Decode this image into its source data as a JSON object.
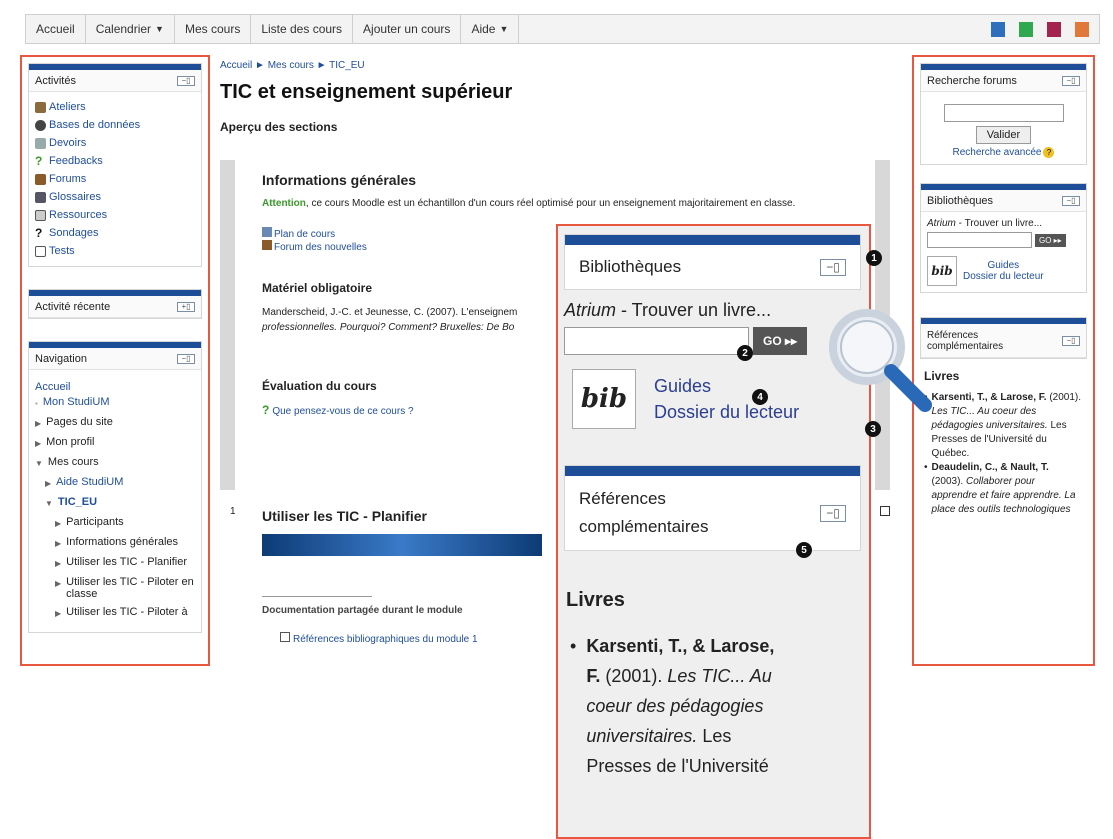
{
  "topnav": {
    "items": [
      {
        "label": "Accueil"
      },
      {
        "label": "Calendrier",
        "caret": "▼"
      },
      {
        "label": "Mes cours"
      },
      {
        "label": "Liste des cours"
      },
      {
        "label": "Ajouter un cours"
      },
      {
        "label": "Aide",
        "caret": "▼"
      }
    ],
    "swatches": [
      "#2f6ebd",
      "#2fa84f",
      "#a3254f",
      "#e0783a"
    ]
  },
  "left": {
    "activites": {
      "title": "Activités",
      "items": [
        "Ateliers",
        "Bases de données",
        "Devoirs",
        "Feedbacks",
        "Forums",
        "Glossaires",
        "Ressources",
        "Sondages",
        "Tests"
      ]
    },
    "recent": {
      "title": "Activité récente"
    },
    "navigation": {
      "title": "Navigation",
      "home": "Accueil",
      "my_studium": "Mon StudiUM",
      "site_pages": "Pages du site",
      "profile": "Mon profil",
      "my_courses": "Mes cours",
      "aide": "Aide StudiUM",
      "course": "TIC_EU",
      "participants": "Participants",
      "infos": "Informations générales",
      "planifier": "Utiliser les TIC - Planifier",
      "piloter": "Utiliser les TIC - Piloter en classe",
      "piloter2": "Utiliser les TIC - Piloter à"
    }
  },
  "main": {
    "breadcrumb": "Accueil ► Mes cours ► TIC_EU",
    "title": "TIC et enseignement supérieur",
    "overview": "Aperçu des sections",
    "section0": {
      "title": "Informations générales",
      "attention": "Attention",
      "text": ", ce cours Moodle est un échantillon d'un cours réel optimisé pour un enseignement majoritairement en classe.",
      "link1": "Plan de cours",
      "link2": "Forum des nouvelles",
      "materiel_title": "Matériel obligatoire",
      "materiel_text1": "Manderscheid, J.-C. et Jeunesse, C. (2007). L'enseignem",
      "materiel_text2": "professionnelles. Pourquoi? Comment? Bruxelles: De Bo",
      "eval_title": "Évaluation du cours",
      "eval_link": "Que pensez-vous de ce cours ?"
    },
    "section1": {
      "number": "1",
      "title": "Utiliser les TIC - Planifier",
      "doc_title": "Documentation partagée durant le module",
      "doc_link": "Références bibliographiques du module 1"
    }
  },
  "right": {
    "forum_search": {
      "title": "Recherche forums",
      "button": "Valider",
      "advanced": "Recherche avancée"
    },
    "libraries": {
      "title": "Bibliothèques",
      "atrium": "Atrium",
      "find": " - Trouver un livre...",
      "go": "GO ▸▸",
      "guides": "Guides",
      "dossier": "Dossier du lecteur",
      "logo": "bib"
    },
    "refs": {
      "title": "Références complémentaires",
      "livres": "Livres",
      "book1_authors": "Karsenti, T., & Larose, F.",
      "book1_rest": " (2001). ",
      "book1_title": "Les TIC... Au coeur des pédagogies universitaires.",
      "book1_pub": " Les Presses de l'Université du Québec.",
      "book2_authors": "Deaudelin, C., & Nault, T.",
      "book2_rest": " (2003). ",
      "book2_title": "Collaborer pour apprendre et faire apprendre. La place des outils technologiques"
    }
  },
  "zoom": {
    "libraries_title": "Bibliothèques",
    "atrium": "Atrium",
    "find": " - Trouver un livre...",
    "go": "GO ▸▸",
    "logo": "bib",
    "guides": "Guides",
    "dossier": "Dossier du lecteur",
    "refs_line1": "Références",
    "refs_line2": "complémentaires",
    "livres": "Livres",
    "book_authors": "Karsenti, T., & Larose,",
    "book_authors2": "F.",
    "book_year": " (2001). ",
    "book_title1": "Les TIC... Au",
    "book_title2": "coeur des pédagogies",
    "book_title3": "universitaires.",
    "book_pub1": " Les",
    "book_pub2": "Presses de l'Université"
  },
  "markers": [
    "1",
    "2",
    "3",
    "4",
    "5"
  ]
}
